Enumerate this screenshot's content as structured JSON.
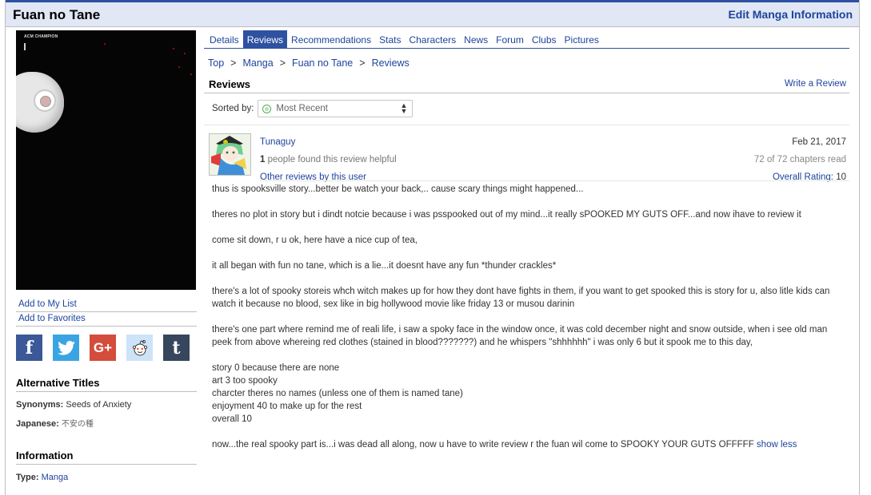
{
  "header": {
    "title": "Fuan no Tane",
    "edit_link": "Edit Manga Information"
  },
  "cover": {
    "publisher_mark": "ACM CHAMPION"
  },
  "sidebar": {
    "links": [
      "Add to My List",
      "Add to Favorites"
    ],
    "social": [
      {
        "icon": "facebook-icon",
        "glyph": "f",
        "color": "#3b5998"
      },
      {
        "icon": "twitter-icon",
        "glyph": "",
        "color": "#3aa4e3"
      },
      {
        "icon": "google-plus-icon",
        "glyph": "G+",
        "color": "#d44c3c"
      },
      {
        "icon": "reddit-icon",
        "glyph": "",
        "color": "#cee3f8"
      },
      {
        "icon": "tumblr-icon",
        "glyph": "t",
        "color": "#36465d"
      }
    ],
    "alt_titles": {
      "heading": "Alternative Titles",
      "synonyms_label": "Synonyms:",
      "synonyms_value": "Seeds of Anxiety",
      "japanese_label": "Japanese:",
      "japanese_value": "不安の種"
    },
    "information": {
      "heading": "Information",
      "type_label": "Type:",
      "type_value": "Manga"
    }
  },
  "tabs": [
    "Details",
    "Reviews",
    "Recommendations",
    "Stats",
    "Characters",
    "News",
    "Forum",
    "Clubs",
    "Pictures"
  ],
  "active_tab": "Reviews",
  "breadcrumb": [
    "Top",
    "Manga",
    "Fuan no Tane",
    "Reviews"
  ],
  "reviews_section": {
    "title": "Reviews",
    "write_link": "Write a Review",
    "sort_label": "Sorted by:",
    "sort_value": "Most Recent"
  },
  "review": {
    "username": "Tunaguy",
    "helpful_count": "1",
    "helpful_text": " people found this review helpful",
    "other_reviews": "Other reviews by this user",
    "date": "Feb 21, 2017",
    "chapters": "72 of 72 chapters read",
    "rating_label": "Overall Rating:",
    "rating_value": "10",
    "paragraphs": [
      "thus is spooksville story...better be watch your back,.. cause scary things might happened...",
      "theres no plot in story but i dindt notcie because i was psspooked out of my mind...it really sPOOKED MY GUTS OFF...and now ihave to review it",
      "come sit down, r u ok, here have a nice cup of tea,",
      "it all began with fun no tane, which is a lie...it doesnt have any fun *thunder crackles*",
      "there's a lot of spooky storeis whch witch makes up for how they dont have fights in them, if you want to get spooked this is story for u, also litle kids can watch it because no blood, sex like in big hollywood movie like friday 13 or musou darinin",
      "there's one part where remind me of reali life, i saw a spoky face in the window once, it was cold december night and snow outside, when i see old man peek from above whereing red clothes (stained in blood???????) and he whispers \"shhhhhh\" i was only 6 but it spook me to this day,"
    ],
    "scores": [
      "story 0 because there are none",
      "art 3 too spooky",
      "charcter theres no names (unless one of them is named tane)",
      "enjoyment 40 to make up for the rest",
      "overall 10"
    ],
    "final": "now...the real spooky part is...i was dead all along, now u have to write review r the fuan wil come to SPOOKY YOUR GUTS OFFFFF",
    "show_less": "show less"
  }
}
